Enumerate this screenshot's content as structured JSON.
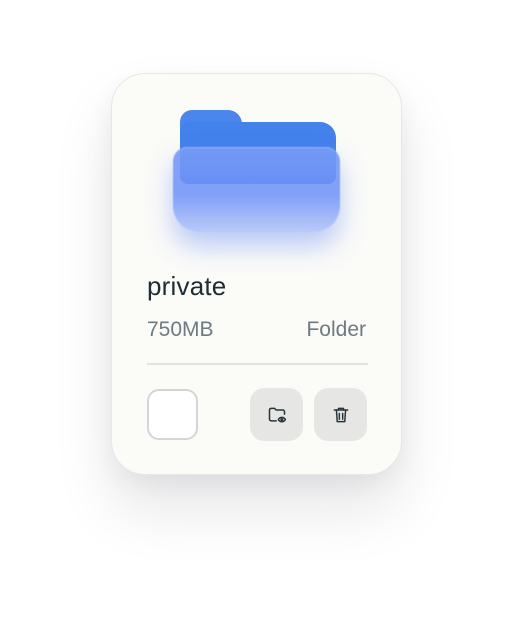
{
  "card": {
    "name": "private",
    "size": "750MB",
    "type": "Folder"
  },
  "actions": {
    "view_icon": "folder-eye-icon",
    "delete_icon": "trash-icon"
  },
  "colors": {
    "folder_blue": "#4381eb",
    "folder_front": "#6b8ff7",
    "card_bg": "#fbfbf8",
    "button_bg": "#e6e7e5"
  }
}
